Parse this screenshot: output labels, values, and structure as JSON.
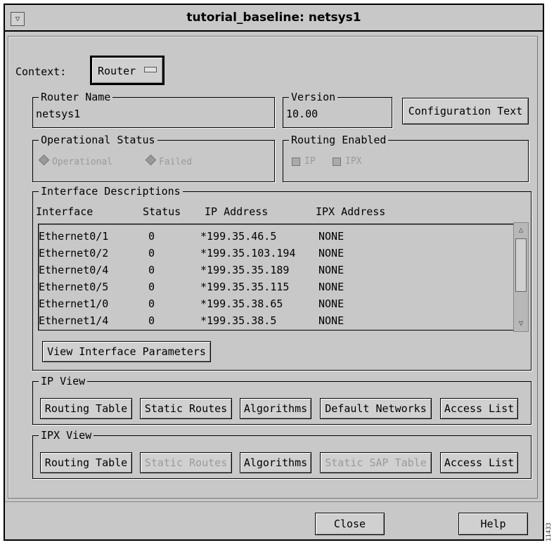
{
  "window": {
    "title": "tutorial_baseline: netsys1",
    "menu_glyph": "▽"
  },
  "context": {
    "label": "Context:",
    "value": "Router",
    "indicator": "▭"
  },
  "router_name": {
    "label": "Router Name",
    "value": "netsys1"
  },
  "version": {
    "label": "Version",
    "value": "10.00"
  },
  "config_button": "Configuration Text",
  "operational_status": {
    "label": "Operational Status",
    "options": [
      "Operational",
      "Failed"
    ]
  },
  "routing_enabled": {
    "label": "Routing Enabled",
    "options": [
      "IP",
      "IPX"
    ]
  },
  "interfaces": {
    "label": "Interface Descriptions",
    "columns": [
      "Interface",
      "Status",
      "IP Address",
      "IPX Address"
    ],
    "rows": [
      [
        "Ethernet0/1",
        "0",
        "*199.35.46.5",
        "NONE"
      ],
      [
        "Ethernet0/2",
        "0",
        "*199.35.103.194",
        "NONE"
      ],
      [
        "Ethernet0/4",
        "0",
        "*199.35.35.189",
        "NONE"
      ],
      [
        "Ethernet0/5",
        "0",
        "*199.35.35.115",
        "NONE"
      ],
      [
        "Ethernet1/0",
        "0",
        "*199.35.38.65",
        "NONE"
      ],
      [
        "Ethernet1/4",
        "0",
        "*199.35.38.5",
        "NONE"
      ]
    ],
    "view_button": "View Interface Parameters",
    "scroll_up": "△",
    "scroll_down": "▽"
  },
  "ip_view": {
    "label": "IP View",
    "buttons": [
      "Routing Table",
      "Static Routes",
      "Algorithms",
      "Default Networks",
      "Access List"
    ]
  },
  "ipx_view": {
    "label": "IPX View",
    "buttons": [
      "Routing Table",
      "Static Routes",
      "Algorithms",
      "Static SAP Table",
      "Access List"
    ]
  },
  "footer": {
    "close": "Close",
    "help": "Help"
  },
  "side_id": "11433"
}
